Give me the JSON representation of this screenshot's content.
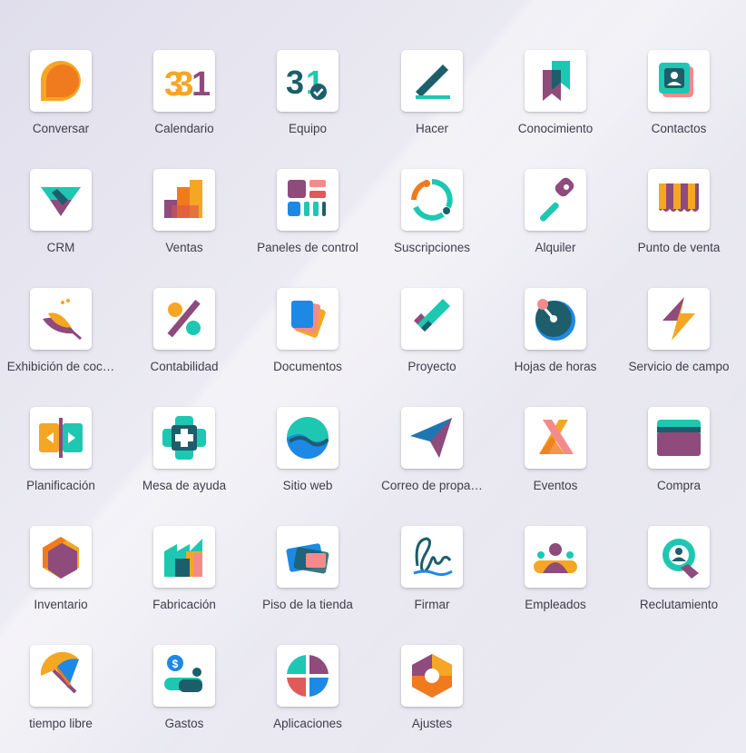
{
  "apps": [
    {
      "label": "Conversar",
      "icon": "chat-bubble-icon"
    },
    {
      "label": "Calendario",
      "icon": "calendar-icon"
    },
    {
      "label": "Equipo",
      "icon": "calendar-check-icon"
    },
    {
      "label": "Hacer",
      "icon": "pencil-line-icon"
    },
    {
      "label": "Conocimiento",
      "icon": "bookmark-icon"
    },
    {
      "label": "Contactos",
      "icon": "contact-card-icon"
    },
    {
      "label": "CRM",
      "icon": "handshake-icon"
    },
    {
      "label": "Ventas",
      "icon": "bar-chart-icon"
    },
    {
      "label": "Paneles de control",
      "icon": "dashboard-grid-icon"
    },
    {
      "label": "Suscripciones",
      "icon": "circular-arrows-icon"
    },
    {
      "label": "Alquiler",
      "icon": "key-icon"
    },
    {
      "label": "Punto de venta",
      "icon": "shop-awning-icon"
    },
    {
      "label": "Exhibición de coc…",
      "icon": "whisk-bowl-icon"
    },
    {
      "label": "Contabilidad",
      "icon": "percent-icon"
    },
    {
      "label": "Documentos",
      "icon": "documents-icon"
    },
    {
      "label": "Proyecto",
      "icon": "checkmark-icon"
    },
    {
      "label": "Hojas de horas",
      "icon": "timer-icon"
    },
    {
      "label": "Servicio de campo",
      "icon": "lightning-icon"
    },
    {
      "label": "Planificación",
      "icon": "planning-arrows-icon"
    },
    {
      "label": "Mesa de ayuda",
      "icon": "helpdesk-cross-icon"
    },
    {
      "label": "Sitio web",
      "icon": "globe-wave-icon"
    },
    {
      "label": "Correo de propa…",
      "icon": "paper-plane-icon"
    },
    {
      "label": "Eventos",
      "icon": "event-x-icon"
    },
    {
      "label": "Compra",
      "icon": "credit-card-icon"
    },
    {
      "label": "Inventario",
      "icon": "hexagon-box-icon"
    },
    {
      "label": "Fabricación",
      "icon": "factory-icon"
    },
    {
      "label": "Piso de la tienda",
      "icon": "tablet-icon"
    },
    {
      "label": "Firmar",
      "icon": "signature-icon"
    },
    {
      "label": "Empleados",
      "icon": "people-icon"
    },
    {
      "label": "Reclutamiento",
      "icon": "magnifier-person-icon"
    },
    {
      "label": "tiempo libre",
      "icon": "umbrella-icon"
    },
    {
      "label": "Gastos",
      "icon": "money-hand-icon"
    },
    {
      "label": "Aplicaciones",
      "icon": "apps-quadrant-icon"
    },
    {
      "label": "Ajustes",
      "icon": "gear-hexagon-icon"
    }
  ]
}
